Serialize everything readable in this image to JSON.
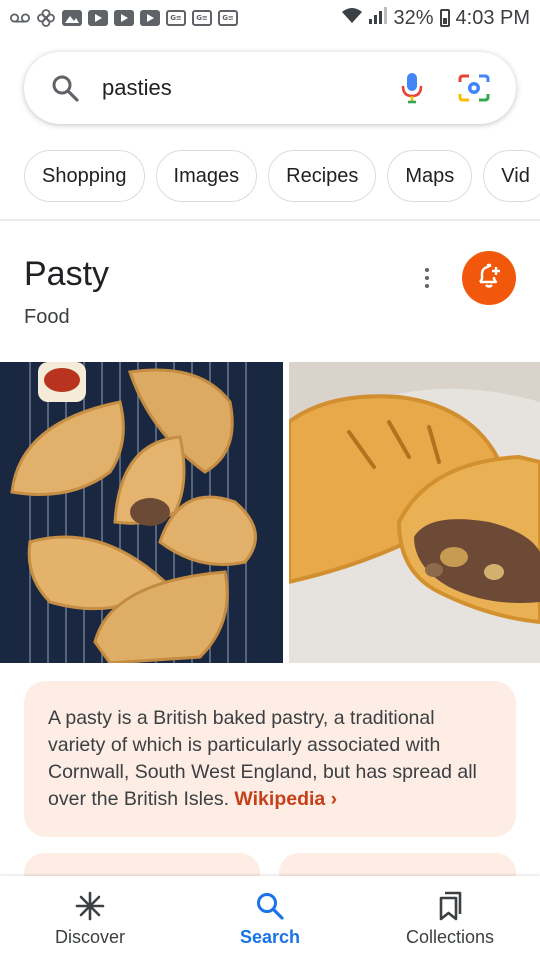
{
  "status_bar": {
    "battery": "32%",
    "time": "4:03 PM",
    "icons": [
      "voicemail-icon",
      "pinwheel-icon",
      "gallery-icon",
      "youtube-icon",
      "youtube-icon",
      "youtube-icon",
      "translate-icon",
      "translate-icon",
      "translate-icon",
      "wifi-icon",
      "signal-icon",
      "battery-icon"
    ],
    "notification_text_icon": "G≡"
  },
  "search": {
    "query": "pasties",
    "icons": {
      "search": "search-icon",
      "mic": "mic-icon",
      "lens": "lens-icon"
    }
  },
  "chips": [
    {
      "label": "Shopping"
    },
    {
      "label": "Images"
    },
    {
      "label": "Recipes"
    },
    {
      "label": "Maps"
    },
    {
      "label": "Vid"
    }
  ],
  "knowledge_panel": {
    "title": "Pasty",
    "subtitle": "Food",
    "follow_icon": "bell-plus-icon",
    "menu_icon": "more-vert-icon",
    "images": [
      "Pasties on cooling rack",
      "Cut pasty showing filling"
    ],
    "description": "A pasty is a British baked pastry, a traditional variety of which is particularly associated with Cornwall, South West England, but has spread all over the British Isles.",
    "source_link": "Wikipedia ›"
  },
  "bottom_nav": [
    {
      "label": "Discover",
      "icon": "asterisk-icon"
    },
    {
      "label": "Search",
      "icon": "search-icon",
      "active": true
    },
    {
      "label": "Collections",
      "icon": "bookmark-stack-icon"
    }
  ],
  "colors": {
    "accent_orange": "#f1580c",
    "card_bg": "#fdede4",
    "link": "#c5401a",
    "active_blue": "#1a73e8"
  }
}
